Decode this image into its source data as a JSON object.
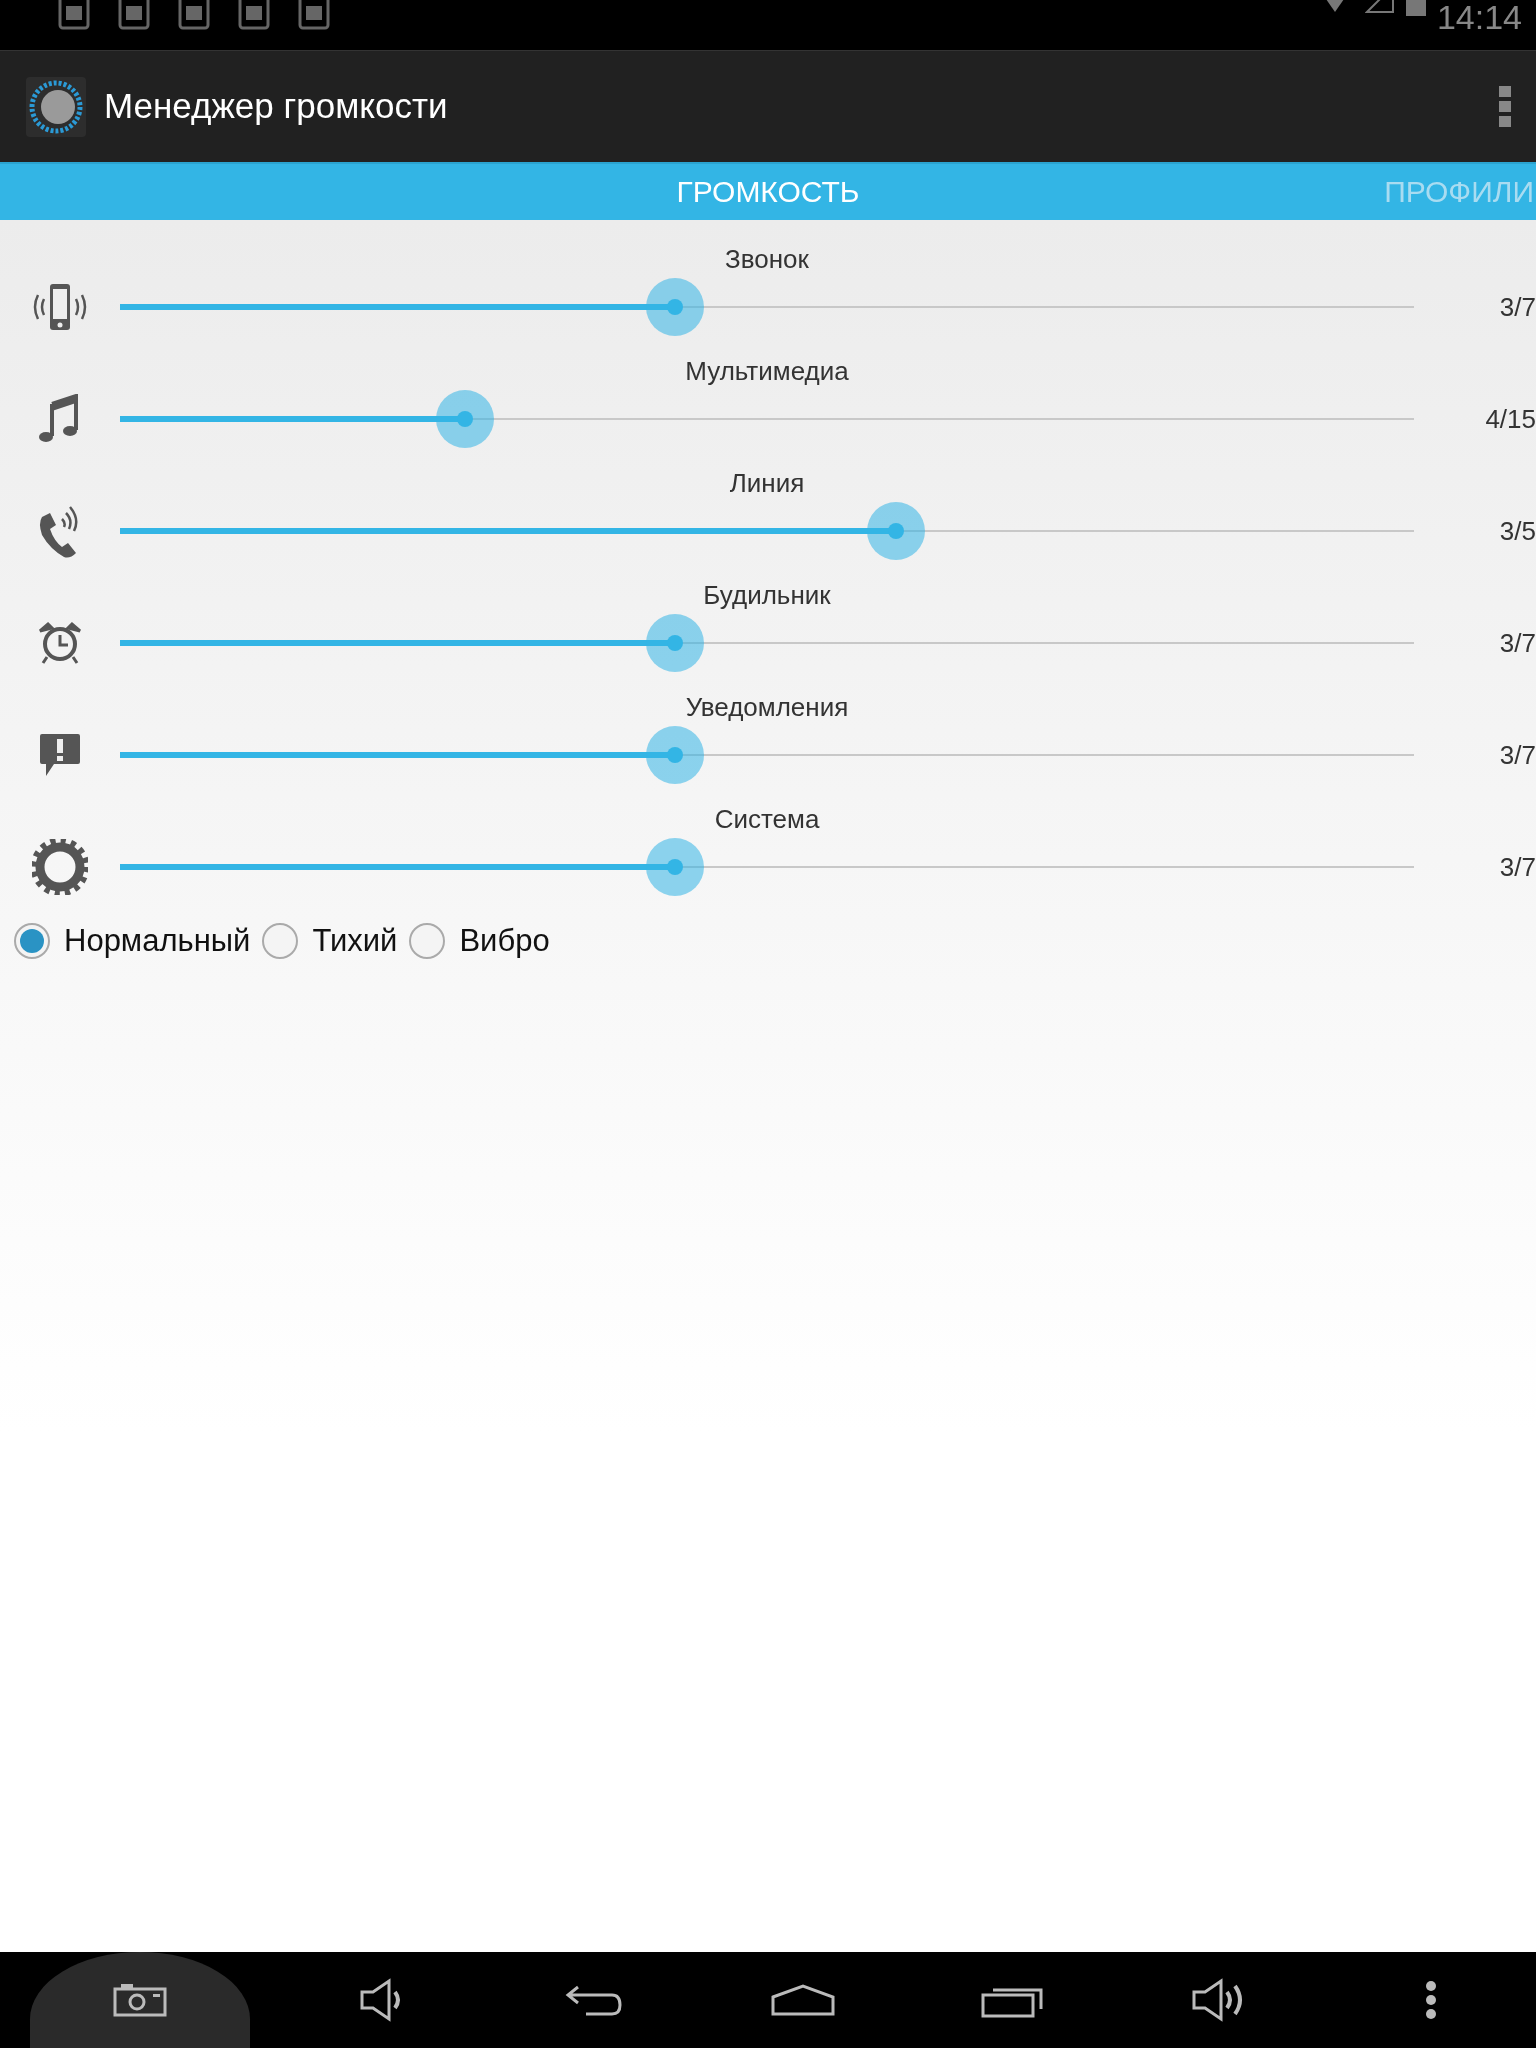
{
  "status_bar": {
    "time": "14:14"
  },
  "action_bar": {
    "title": "Менеджер громкости"
  },
  "tabs": [
    {
      "label": "ГРОМКОСТЬ",
      "selected": true
    },
    {
      "label": "ПРОФИЛИ",
      "selected": false
    }
  ],
  "channels": [
    {
      "kind": "ring",
      "label": "Звонок",
      "level": 0.4286,
      "reading": "3/7"
    },
    {
      "kind": "media",
      "label": "Мультимедиа",
      "level": 0.2667,
      "reading": "4/15"
    },
    {
      "kind": "call",
      "label": "Линия",
      "level": 0.6,
      "reading": "3/5"
    },
    {
      "kind": "alarm",
      "label": "Будильник",
      "level": 0.4286,
      "reading": "3/7"
    },
    {
      "kind": "notification",
      "label": "Уведомления",
      "level": 0.4286,
      "reading": "3/7"
    },
    {
      "kind": "system",
      "label": "Система",
      "level": 0.4286,
      "reading": "3/7"
    }
  ],
  "modes": [
    {
      "label": "Нормальный",
      "selected": true
    },
    {
      "label": "Тихий",
      "selected": false
    },
    {
      "label": "Вибро",
      "selected": false
    }
  ]
}
